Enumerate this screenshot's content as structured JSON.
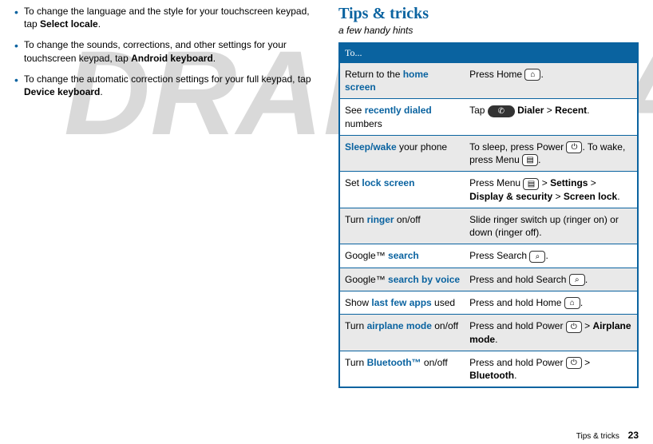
{
  "watermark": "DRAFT",
  "left_bullets": [
    {
      "pre": "To change the language and the style for your touchscreen keypad, tap ",
      "bold": "Select locale",
      "post": "."
    },
    {
      "pre": "To change the sounds, corrections, and other settings for your touchscreen keypad, tap ",
      "bold": "Android keyboard",
      "post": "."
    },
    {
      "pre": "To change the automatic correction settings for your full keypad, tap ",
      "bold": "Device keyboard",
      "post": "."
    }
  ],
  "section": {
    "title": "Tips & tricks",
    "subtitle": "a few handy hints",
    "header": "To..."
  },
  "rows": [
    {
      "left_pre": "Return to the ",
      "left_hl": "home screen",
      "left_post": "",
      "right_parts": [
        "Press Home ",
        {
          "icon": "home"
        },
        "."
      ]
    },
    {
      "left_pre": "See ",
      "left_hl": "recently dialed",
      "left_post": " numbers",
      "right_parts": [
        "Tap ",
        {
          "icon": "dialer"
        },
        " ",
        {
          "bold": "Dialer"
        },
        " > ",
        {
          "bold": "Recent"
        },
        "."
      ]
    },
    {
      "left_hl": "Sleep/wake",
      "left_post": " your phone",
      "right_parts": [
        "To sleep, press Power ",
        {
          "icon": "power"
        },
        ". To wake, press Menu ",
        {
          "icon": "menu"
        },
        "."
      ]
    },
    {
      "left_pre": "Set ",
      "left_hl": "lock screen",
      "right_parts": [
        "Press Menu ",
        {
          "icon": "menu"
        },
        " > ",
        {
          "bold": "Settings"
        },
        " > ",
        {
          "bold": "Display & security"
        },
        " > ",
        {
          "bold": "Screen lock"
        },
        "."
      ]
    },
    {
      "left_pre": "Turn ",
      "left_hl": "ringer",
      "left_post": " on/off",
      "right_parts": [
        "Slide ringer switch up (ringer on) or down (ringer off)."
      ]
    },
    {
      "left_pre": "Google™ ",
      "left_hl": "search",
      "right_parts": [
        "Press Search ",
        {
          "icon": "search"
        },
        "."
      ]
    },
    {
      "left_pre": "Google™ ",
      "left_hl": "search by voice",
      "right_parts": [
        "Press and hold Search ",
        {
          "icon": "search"
        },
        "."
      ]
    },
    {
      "left_pre": "Show ",
      "left_hl": "last few apps",
      "left_post": " used",
      "right_parts": [
        "Press and hold Home ",
        {
          "icon": "home"
        },
        "."
      ]
    },
    {
      "left_pre": "Turn ",
      "left_hl": "airplane mode",
      "left_post": " on/off",
      "right_parts": [
        "Press and hold Power ",
        {
          "icon": "power"
        },
        " > ",
        {
          "bold": "Airplane mode"
        },
        "."
      ]
    },
    {
      "left_pre": "Turn ",
      "left_hl": "Bluetooth™",
      "left_post": " on/off",
      "right_parts": [
        "Press and hold Power ",
        {
          "icon": "power"
        },
        " > ",
        {
          "bold": "Bluetooth"
        },
        "."
      ]
    }
  ],
  "footer_label": "Tips & tricks",
  "page_number": "23",
  "icons": {
    "home": "⌂",
    "power": "⏻",
    "menu": "▤",
    "search": "⌕",
    "dialer": "✆"
  }
}
